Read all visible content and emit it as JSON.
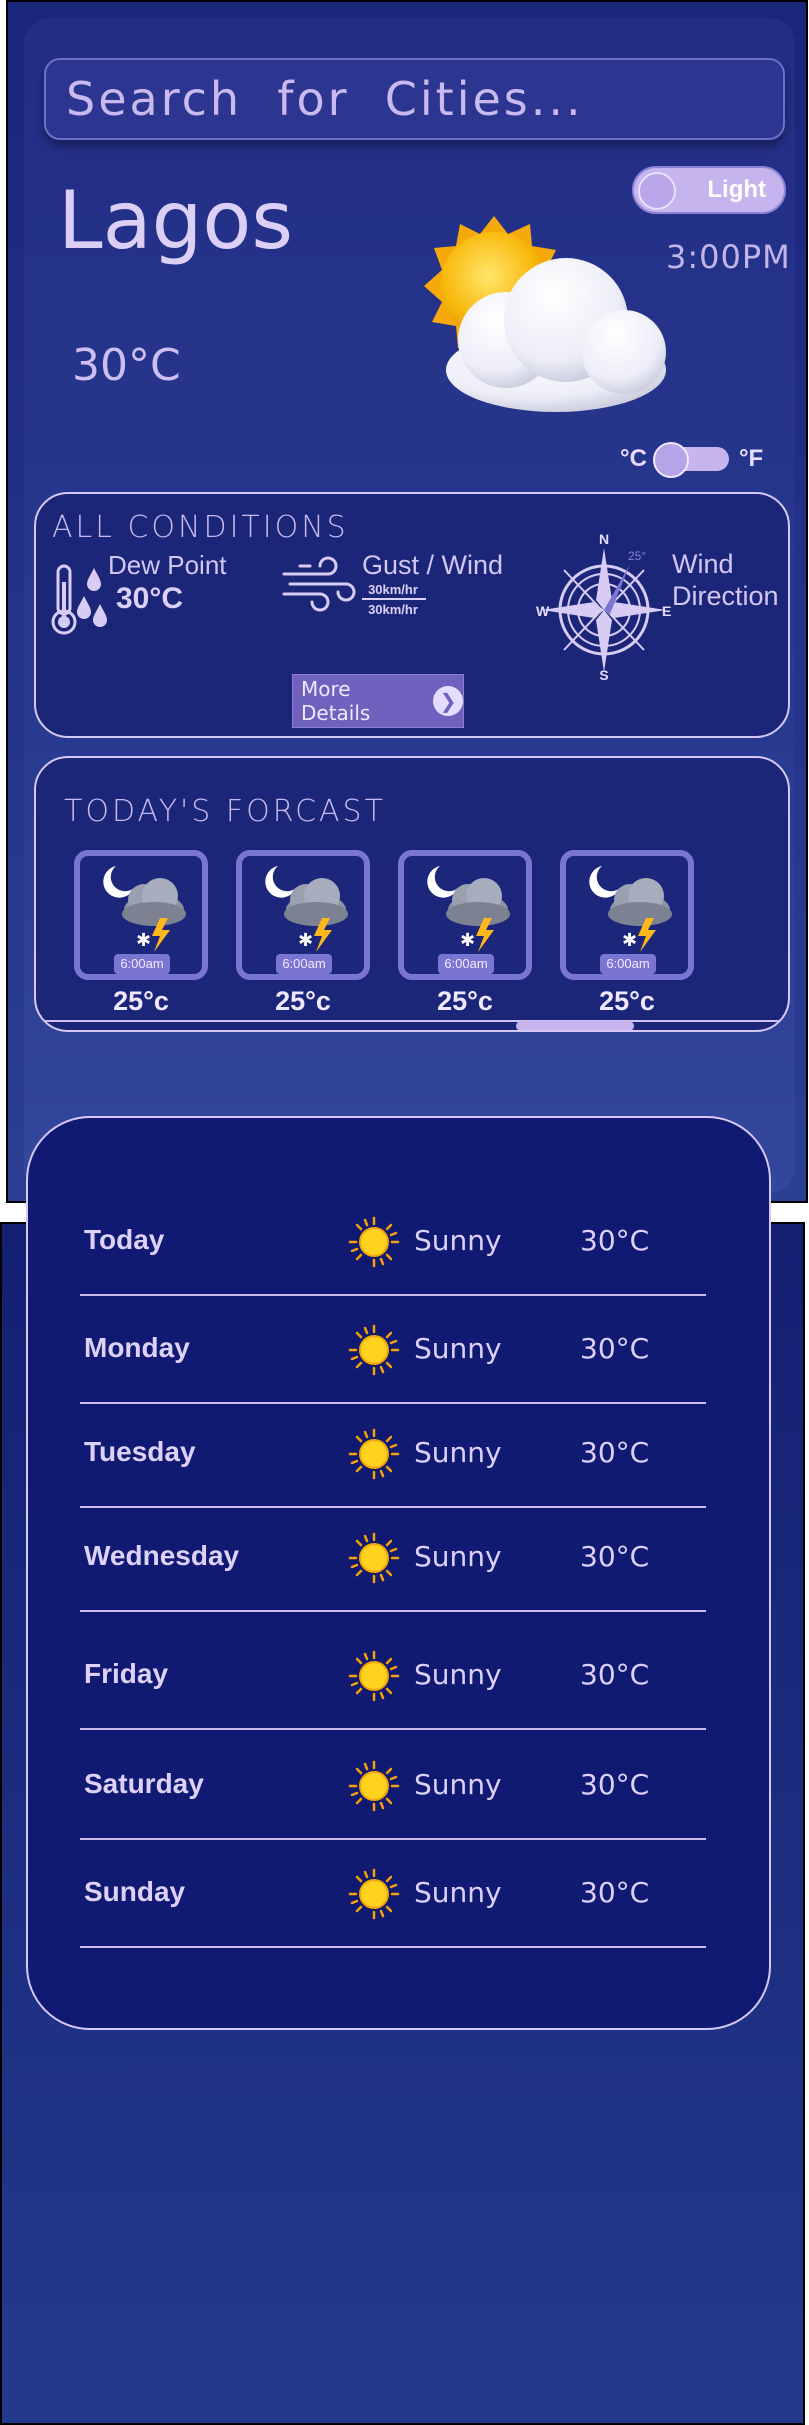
{
  "search": {
    "placeholder": "Search  for  Cities..."
  },
  "location": {
    "city": "Lagos",
    "temperature": "30°C",
    "time": "3:00PM",
    "current_icon": "sun-behind-cloud-icon"
  },
  "theme_toggle": {
    "label": "Light",
    "state": "light"
  },
  "unit_toggle": {
    "celsius_label": "°C",
    "fahrenheit_label": "°F",
    "selected": "°C"
  },
  "conditions": {
    "title": "ALL  CONDITIONS",
    "dew_point": {
      "label": "Dew Point",
      "value": "30°C",
      "icon": "thermometer-drops-icon"
    },
    "gust_wind": {
      "label": "Gust / Wind",
      "gust": "30km/hr",
      "wind": "30km/hr",
      "icon": "wind-icon"
    },
    "wind_direction": {
      "label_line1": "Wind",
      "label_line2": "Direction",
      "degrees": "25°",
      "north": "N",
      "east": "E",
      "south": "S",
      "west": "W",
      "icon": "compass-icon"
    },
    "more_details": "More Details"
  },
  "forecast": {
    "title": "TODAY'S  FORCAST",
    "items": [
      {
        "time": "6:00am",
        "temp": "25°c",
        "icon": "night-thunder-snow-icon"
      },
      {
        "time": "6:00am",
        "temp": "25°c",
        "icon": "night-thunder-snow-icon"
      },
      {
        "time": "6:00am",
        "temp": "25°c",
        "icon": "night-thunder-snow-icon"
      },
      {
        "time": "6:00am",
        "temp": "25°c",
        "icon": "night-thunder-snow-icon"
      }
    ]
  },
  "weekly": [
    {
      "day": "Today",
      "condition": "Sunny",
      "temp": "30°C",
      "icon": "sun-icon"
    },
    {
      "day": "Monday",
      "condition": "Sunny",
      "temp": "30°C",
      "icon": "sun-icon"
    },
    {
      "day": "Tuesday",
      "condition": "Sunny",
      "temp": "30°C",
      "icon": "sun-icon"
    },
    {
      "day": "Wednesday",
      "condition": "Sunny",
      "temp": "30°C",
      "icon": "sun-icon"
    },
    {
      "day": "Friday",
      "condition": "Sunny",
      "temp": "30°C",
      "icon": "sun-icon"
    },
    {
      "day": "Saturday",
      "condition": "Sunny",
      "temp": "30°C",
      "icon": "sun-icon"
    },
    {
      "day": "Sunday",
      "condition": "Sunny",
      "temp": "30°C",
      "icon": "sun-icon"
    }
  ],
  "colors": {
    "panel": "#1b2679",
    "accent": "#c5b4ee",
    "card_border": "#7a74d2",
    "text": "#d8ccf4"
  }
}
